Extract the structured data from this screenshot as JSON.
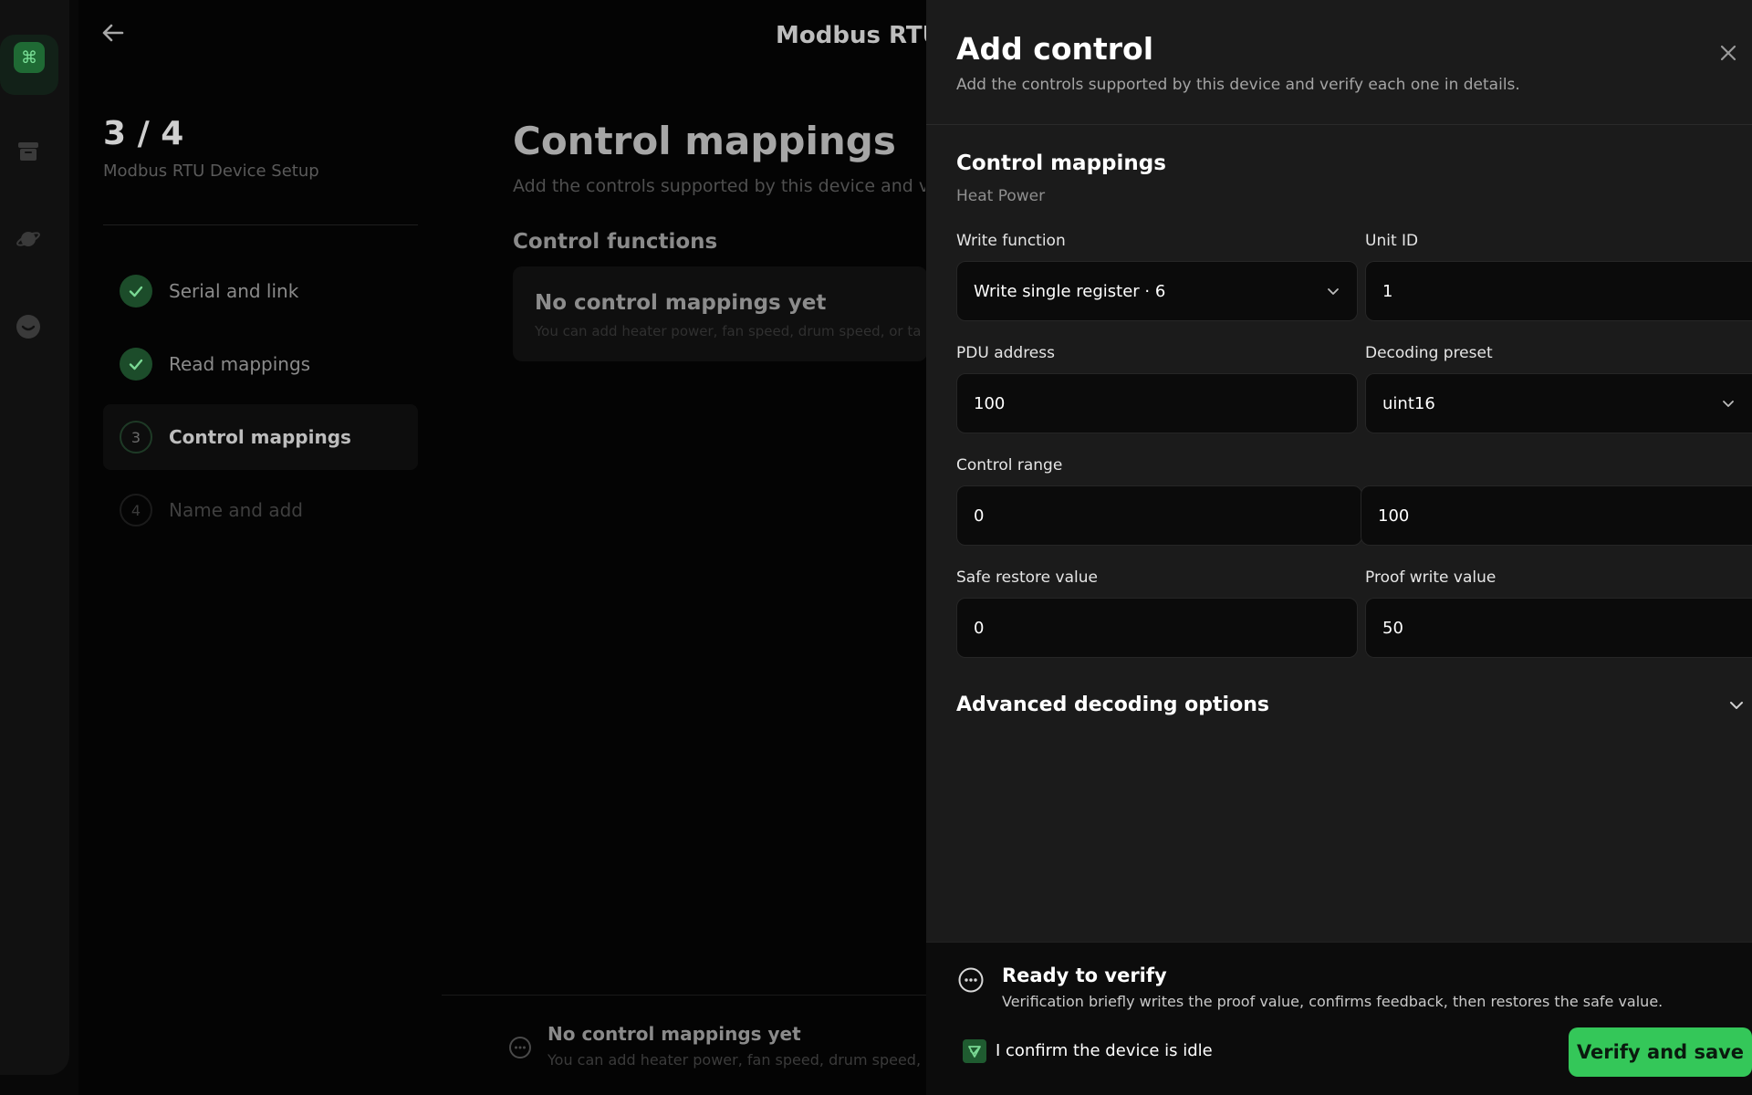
{
  "topbar": {
    "title": "Modbus RTU"
  },
  "stepper": {
    "count": "3 / 4",
    "subtitle": "Modbus RTU Device Setup",
    "steps": [
      {
        "label": "Serial and link",
        "state": "done",
        "badge": ""
      },
      {
        "label": "Read mappings",
        "state": "done",
        "badge": ""
      },
      {
        "label": "Control mappings",
        "state": "active",
        "badge": "3"
      },
      {
        "label": "Name and add",
        "state": "pending",
        "badge": "4"
      }
    ]
  },
  "main": {
    "title": "Control mappings",
    "description": "Add the controls supported by this device and verify each one in details.",
    "functions_title": "Control functions",
    "empty_title": "No control mappings yet",
    "empty_desc": "You can add heater power, fan speed, drum speed, or ta"
  },
  "bottom_note": {
    "title": "No control mappings yet",
    "desc": "You can add heater power, fan speed, drum speed, or"
  },
  "drawer": {
    "title": "Add control",
    "subtitle": "Add the controls supported by this device and verify each one in details.",
    "section_title": "Control mappings",
    "section_sub": "Heat Power",
    "fields": {
      "write_function": {
        "label": "Write function",
        "value": "Write single register · 6"
      },
      "unit_id": {
        "label": "Unit ID",
        "value": "1"
      },
      "pdu_address": {
        "label": "PDU address",
        "value": "100"
      },
      "decoding_preset": {
        "label": "Decoding preset",
        "value": "uint16"
      },
      "control_range": {
        "label": "Control range",
        "min": "0",
        "max": "100"
      },
      "safe_restore": {
        "label": "Safe restore value",
        "value": "0"
      },
      "proof_write": {
        "label": "Proof write value",
        "value": "50"
      }
    },
    "advanced": "Advanced decoding options",
    "footer": {
      "ready_title": "Ready to verify",
      "ready_desc": "Verification briefly writes the proof value, confirms feedback, then restores the safe value.",
      "confirm_label": "I confirm the device is idle",
      "confirm_checked": true,
      "verify_button": "Verify and save"
    }
  },
  "colors": {
    "accent": "#34c759",
    "drawer_bg": "#1b1b1b",
    "field_bg": "#0b0b0b"
  },
  "icons": {
    "back": "arrow-left-icon",
    "close": "close-icon",
    "chevron": "chevron-down-icon",
    "status": "more-circle-icon",
    "check": "check-icon"
  }
}
